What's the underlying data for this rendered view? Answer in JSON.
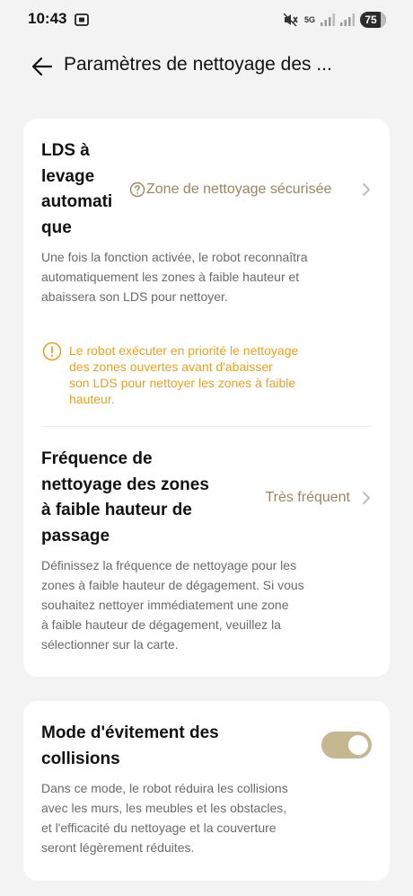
{
  "status_bar": {
    "time": "10:43",
    "battery": "75",
    "network": "5G"
  },
  "header": {
    "title": "Paramètres de nettoyage des ..."
  },
  "settings": {
    "lds": {
      "title": [
        "LDS à",
        "levage",
        "automati",
        "que"
      ],
      "value": "Zone de nettoyage sécurisée",
      "description": [
        "Une fois la fonction activée, le robot reconnaîtra",
        "automatiquement les zones à faible hauteur et",
        "abaissera son LDS pour nettoyer."
      ],
      "warning": [
        "Le robot exécuter en priorité le nettoyage",
        "des zones ouvertes avant d'abaisser",
        "son LDS pour nettoyer les zones à faible",
        "hauteur."
      ]
    },
    "frequency": {
      "title": [
        "Fréquence de",
        "nettoyage des zones",
        "à faible hauteur de",
        "passage"
      ],
      "value": "Très fréquent",
      "description": [
        "Définissez la fréquence de nettoyage pour les",
        "zones à faible hauteur de dégagement. Si vous",
        "souhaitez nettoyer immédiatement une zone",
        "à faible hauteur de dégagement, veuillez la",
        "sélectionner sur la carte."
      ]
    },
    "collision": {
      "title": [
        "Mode d'évitement des",
        "collisions"
      ],
      "toggle_on": true,
      "description": [
        "Dans ce mode, le robot réduira les collisions",
        "avec les murs, les meubles et les obstacles,",
        "et l'efficacité du nettoyage et la couverture",
        "seront légèrement réduites."
      ]
    }
  },
  "colors": {
    "accent": "#9a855f",
    "warning": "#e4a227",
    "toggle_track": "#c6b793",
    "background": "#f3f3f3"
  },
  "icons": {
    "back": "arrow-left-icon",
    "help": "question-circle-icon",
    "chevron": "chevron-right-icon",
    "warning": "exclamation-circle-icon",
    "screen_record": "screen-record-icon",
    "mute": "mute-icon",
    "signal": "signal-icon"
  }
}
